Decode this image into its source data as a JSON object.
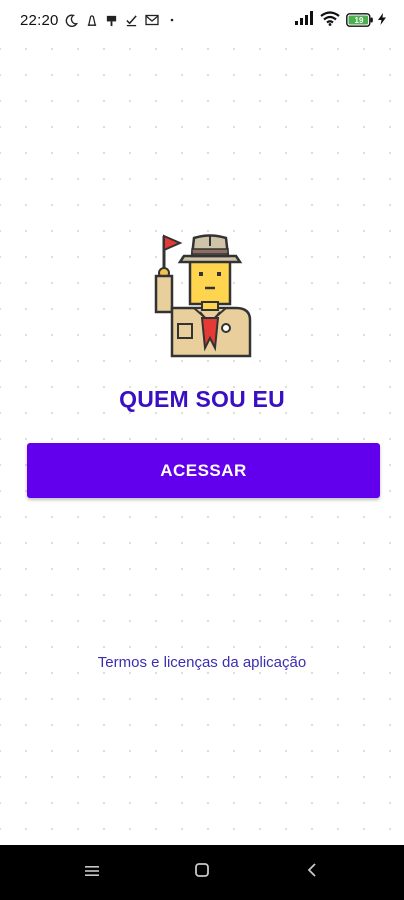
{
  "status_bar": {
    "time": "22:20",
    "battery_level": "19"
  },
  "main": {
    "title": "QUEM SOU EU",
    "access_button_label": "ACESSAR",
    "terms_link": "Termos e licenças da aplicação"
  },
  "colors": {
    "primary": "#6200ee",
    "title": "#3a0fc4",
    "link": "#3a2fb0",
    "nav_bar": "#000000",
    "battery": "#4caf50"
  },
  "nav": {
    "icons": [
      "menu-icon",
      "home-icon",
      "back-icon"
    ]
  }
}
